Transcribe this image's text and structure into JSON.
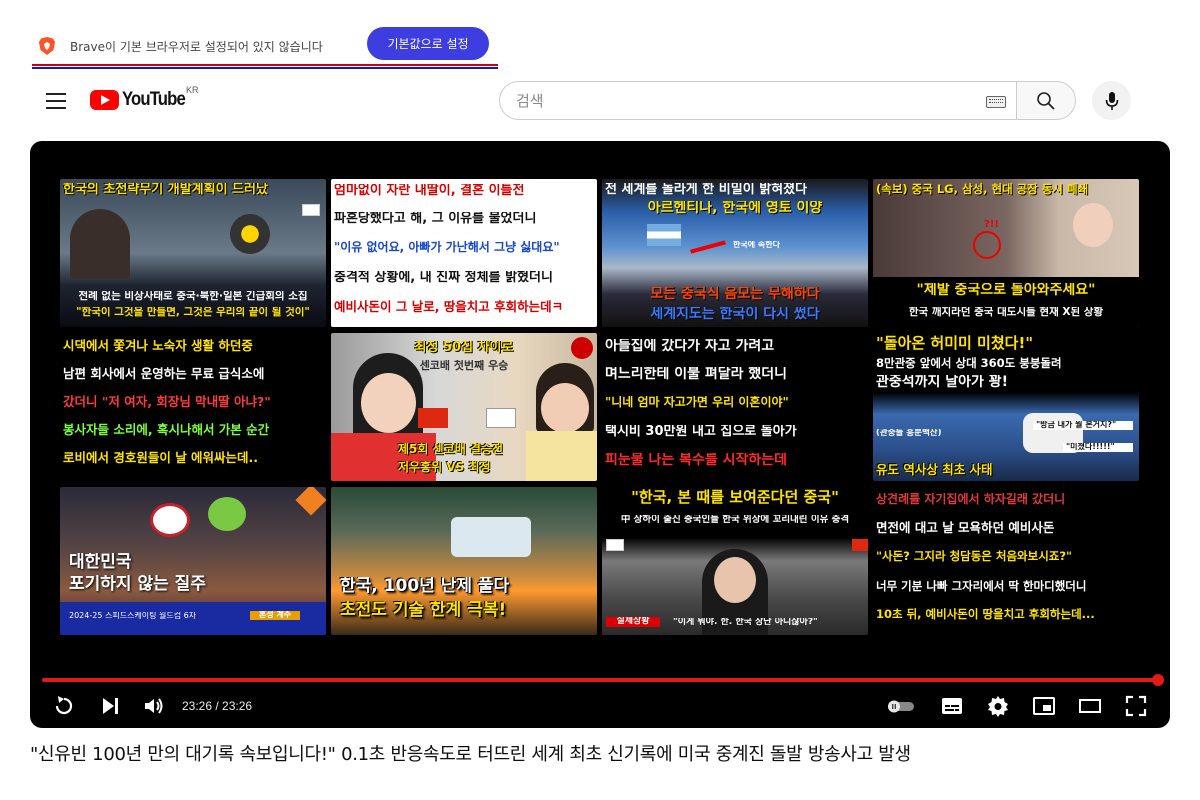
{
  "brave_banner": {
    "message": "Brave이 기본 브라우저로 설정되어 있지 않습니다",
    "button_label": "기본값으로 설정"
  },
  "header": {
    "logo_text": "YouTube",
    "country_code": "KR",
    "search_placeholder": "검색"
  },
  "player": {
    "progress_fraction": 1.0,
    "time_display": "23:26 / 23:26",
    "thumbnails": [
      {
        "lines": [
          "한국의 초전략무기 개발계획이 드러났",
          "전례 없는 비상사태로 중국·북한·일본 긴급회의 소집",
          "\"한국이 그것을 만들면, 그것은 우리의 끝이 될 것이\""
        ]
      },
      {
        "lines": [
          "엄마없이 자란 내딸이, 결혼 이틀전",
          "파혼당했다고 해, 그 이유를 물었더니",
          "\"이유 없어요, 아빠가 가난해서 그냥 싫대요\"",
          "충격적 상황에, 내 진짜 정체를 밝혔더니",
          "예비사돈이 그 날로, 땅을치고 후회하는데ㅋ"
        ]
      },
      {
        "lines": [
          "전 세계를 놀라게 한 비밀이 밝혀졌다",
          "아르헨티나, 한국에 영토 이양",
          "한국에 속한다",
          "모든 중국식 음모는 무해하다",
          "세계지도는 한국이 다시 썼다"
        ]
      },
      {
        "lines": [
          "(속보) 중국 LG, 삼성, 현대 공장 동시 폐쇄",
          "?!!",
          "\"제발 중국으로 돌아와주세요\"",
          "한국 깨지라던 중국 대도시들 현재 X된 상황"
        ]
      },
      {
        "lines": [
          "시댁에서 쫓겨나 노숙자 생활 하던중",
          "남편 회사에서 운영하는 무료 급식소에",
          "갔더니 \"저 여자, 회장님 막내딸 아냐?\"",
          "봉사자들 소리에, 혹시나해서 가본 순간",
          "로비에서 경호원들이 날 에워싸는데.."
        ]
      },
      {
        "lines": [
          "최정 50집 차이로",
          "센코배 첫번째 우승",
          "제5회 센코배 결승전",
          "저우홍위 VS 최정"
        ]
      },
      {
        "lines": [
          "아들집에 갔다가 자고 가려고",
          "며느리한테 이불 펴달라 했더니",
          "\"니네 엄마 자고가면 우리 이혼이야\"",
          "택시비 30만원 내고 집으로 돌아가",
          "피눈물 나는 복수를 시작하는데"
        ]
      },
      {
        "lines": [
          "\"돌아온 허미미 미쳤다!\"",
          "8만관중 앞에서 상대 360도 붕붕돌려",
          "관중석까지 날아가 꽝!",
          "(관중들 흥분백산)",
          "\"방금 내가 뭘 본거지?\"",
          "\"미쳤다!!!!!\"",
          "유도 역사상 최초 사태"
        ]
      },
      {
        "lines": [
          "대한민국",
          "포기하지 않는 질주",
          "2024-25 스피드스케이팅 월드컵 6차",
          "혼성 계주"
        ]
      },
      {
        "lines": [
          "한국, 100년 난제 풀다",
          "초전도 기술 한계 극복!"
        ]
      },
      {
        "lines": [
          "\"한국, 본 때를 보여준다던 중국\"",
          "中 상하이 출신 중국인들 한국 위상에 꼬리내린 이유 충격",
          "실제상황",
          "\"이게 뭐야. 한. 한국 장난 아니잖아?\""
        ]
      },
      {
        "lines": [
          "상견례를 자기집에서 하자길래 갔더니",
          "면전에 대고 날 모욕하던 예비사돈",
          "\"사돈? 그지라 청담동은 처음와보시죠?\"",
          "너무 기분 나빠 그자리에서 딱 한마디했더니",
          "10초 뒤, 예비사돈이 땅을치고 후회하는데..."
        ]
      }
    ]
  },
  "video": {
    "title": "\"신유빈 100년 만의 대기록 속보입니다!\" 0.1초 반응속도로 터뜨린 세계 최초 신기록에 미국 중계진 돌발 방송사고 발생"
  },
  "colors": {
    "brave_button": "#3d3de0",
    "youtube_red": "#ff0000",
    "progress": "#e21a1a",
    "player_bg": "#000000"
  }
}
